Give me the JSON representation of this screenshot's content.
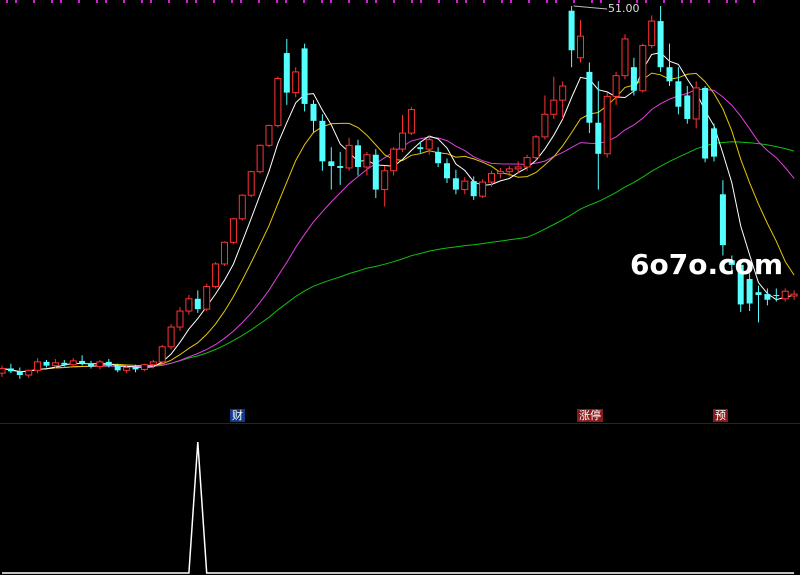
{
  "labels": {
    "finance_tag": "财",
    "limit_up_tag": "涨停",
    "forecast_tag": "预",
    "high_price": "51.00",
    "watermark": "6o7o.com"
  },
  "colors": {
    "background": "#000000",
    "up_candle": "#ff3232",
    "down_candle": "#54ffff",
    "ma5": "#ffffff",
    "ma10": "#e6c800",
    "ma20": "#e040e0",
    "ma60": "#10c010",
    "separator": "#800000",
    "indicator": "#ffffff"
  },
  "chart_data": [
    {
      "type": "candlestick",
      "y_range": [
        10,
        51
      ],
      "series": [
        {
          "name": "price",
          "points": [
            [
              12.0,
              12.8,
              11.6,
              12.5
            ],
            [
              12.5,
              13.0,
              12.0,
              12.2
            ],
            [
              12.2,
              12.6,
              11.4,
              11.8
            ],
            [
              11.8,
              12.4,
              11.5,
              12.3
            ],
            [
              12.3,
              13.6,
              12.0,
              13.2
            ],
            [
              13.2,
              13.4,
              12.6,
              12.8
            ],
            [
              12.8,
              13.5,
              12.5,
              13.1
            ],
            [
              13.1,
              13.4,
              12.7,
              12.9
            ],
            [
              12.9,
              13.6,
              12.6,
              13.3
            ],
            [
              13.3,
              13.9,
              12.8,
              13.0
            ],
            [
              13.0,
              13.3,
              12.5,
              12.7
            ],
            [
              12.7,
              13.4,
              12.4,
              13.2
            ],
            [
              13.2,
              13.5,
              12.6,
              12.8
            ],
            [
              12.8,
              13.0,
              12.1,
              12.3
            ],
            [
              12.3,
              12.8,
              12.0,
              12.6
            ],
            [
              12.6,
              12.9,
              12.1,
              12.4
            ],
            [
              12.4,
              13.0,
              12.2,
              12.9
            ],
            [
              12.9,
              13.4,
              12.5,
              13.2
            ],
            [
              13.2,
              15.0,
              13.0,
              14.8
            ],
            [
              14.8,
              17.2,
              14.5,
              16.9
            ],
            [
              16.9,
              19.0,
              16.5,
              18.6
            ],
            [
              18.6,
              20.3,
              18.2,
              19.9
            ],
            [
              19.9,
              20.8,
              18.4,
              18.8
            ],
            [
              18.8,
              21.5,
              18.6,
              21.2
            ],
            [
              21.2,
              23.8,
              21.0,
              23.6
            ],
            [
              23.6,
              26.0,
              23.4,
              25.9
            ],
            [
              25.9,
              28.5,
              25.7,
              28.4
            ],
            [
              28.4,
              31.0,
              28.2,
              30.9
            ],
            [
              30.9,
              33.5,
              30.7,
              33.4
            ],
            [
              33.4,
              36.3,
              33.2,
              36.2
            ],
            [
              36.2,
              38.4,
              36.0,
              38.3
            ],
            [
              38.3,
              43.5,
              38.1,
              43.3
            ],
            [
              46.0,
              47.5,
              40.5,
              41.8
            ],
            [
              41.8,
              44.5,
              41.3,
              44.0
            ],
            [
              46.5,
              47.0,
              39.8,
              40.6
            ],
            [
              40.6,
              41.0,
              37.5,
              38.8
            ],
            [
              38.8,
              39.5,
              33.5,
              34.5
            ],
            [
              34.5,
              36.0,
              31.5,
              34.0
            ],
            [
              34.0,
              35.5,
              32.0,
              33.8
            ],
            [
              33.8,
              37.0,
              33.5,
              36.2
            ],
            [
              36.2,
              36.8,
              33.0,
              33.9
            ],
            [
              33.9,
              35.5,
              33.0,
              35.2
            ],
            [
              35.2,
              35.8,
              30.6,
              31.5
            ],
            [
              31.5,
              34.0,
              29.7,
              33.5
            ],
            [
              33.5,
              36.0,
              33.0,
              35.8
            ],
            [
              35.8,
              39.4,
              35.5,
              37.5
            ],
            [
              37.5,
              40.3,
              37.3,
              40.0
            ],
            [
              36.0,
              36.6,
              35.4,
              35.8
            ],
            [
              35.8,
              37.2,
              35.2,
              36.8
            ],
            [
              35.5,
              36.0,
              33.9,
              34.3
            ],
            [
              34.3,
              34.8,
              32.2,
              32.7
            ],
            [
              32.7,
              33.6,
              31.0,
              31.5
            ],
            [
              31.5,
              32.8,
              31.0,
              32.4
            ],
            [
              32.4,
              32.9,
              30.4,
              30.8
            ],
            [
              30.8,
              32.6,
              30.6,
              32.3
            ],
            [
              32.3,
              33.5,
              31.8,
              33.2
            ],
            [
              33.2,
              33.8,
              32.7,
              33.4
            ],
            [
              33.4,
              34.0,
              32.9,
              33.7
            ],
            [
              33.7,
              34.5,
              33.2,
              33.9
            ],
            [
              33.9,
              35.2,
              33.5,
              34.9
            ],
            [
              34.9,
              37.3,
              34.6,
              37.1
            ],
            [
              37.1,
              41.5,
              36.8,
              39.5
            ],
            [
              39.5,
              43.5,
              39.0,
              41.0
            ],
            [
              41.0,
              43.0,
              39.0,
              42.5
            ],
            [
              50.5,
              51.0,
              44.5,
              46.3
            ],
            [
              45.5,
              49.5,
              45.0,
              47.8
            ],
            [
              44.0,
              45.0,
              37.5,
              38.6
            ],
            [
              38.6,
              43.0,
              31.5,
              35.3
            ],
            [
              35.3,
              41.8,
              34.9,
              41.4
            ],
            [
              41.4,
              44.0,
              40.5,
              43.6
            ],
            [
              43.6,
              48.0,
              43.2,
              47.5
            ],
            [
              44.5,
              45.5,
              41.5,
              42.0
            ],
            [
              42.0,
              47.0,
              41.8,
              46.8
            ],
            [
              46.8,
              50.0,
              46.5,
              49.4
            ],
            [
              49.4,
              51.0,
              44.0,
              44.5
            ],
            [
              44.5,
              47.0,
              42.5,
              43.0
            ],
            [
              43.0,
              44.5,
              39.5,
              40.3
            ],
            [
              41.5,
              42.5,
              38.5,
              39.0
            ],
            [
              39.0,
              43.0,
              38.0,
              42.3
            ],
            [
              42.3,
              42.5,
              34.4,
              34.8
            ],
            [
              38.0,
              38.5,
              34.5,
              35.0
            ],
            [
              31.0,
              32.5,
              24.5,
              25.6
            ],
            [
              24.0,
              24.5,
              22.5,
              23.5
            ],
            [
              23.5,
              24.0,
              18.5,
              19.3
            ],
            [
              22.0,
              22.6,
              18.6,
              19.4
            ],
            [
              20.6,
              21.3,
              17.4,
              20.3
            ],
            [
              20.4,
              21.0,
              19.2,
              19.8
            ],
            [
              20.3,
              21.0,
              19.6,
              20.2
            ],
            [
              19.9,
              21.0,
              19.6,
              20.7
            ],
            [
              20.2,
              20.8,
              19.8,
              20.4
            ]
          ]
        },
        {
          "name": "MA5"
        },
        {
          "name": "MA10"
        },
        {
          "name": "MA20"
        },
        {
          "name": "MA60"
        }
      ],
      "annotations": [
        {
          "text": "51.00",
          "value": 51.0
        },
        {
          "text": "财",
          "index": 22
        },
        {
          "text": "涨停",
          "index": 56
        },
        {
          "text": "预",
          "index": 70
        }
      ]
    },
    {
      "type": "line",
      "y_range": [
        0,
        1
      ],
      "values": [
        0,
        0,
        0,
        0,
        0,
        0,
        0,
        0,
        0,
        0,
        0,
        0,
        0,
        0,
        0,
        0,
        0,
        0,
        0,
        0,
        0,
        0,
        1,
        0,
        0,
        0,
        0,
        0,
        0,
        0,
        0,
        0,
        0,
        0,
        0,
        0,
        0,
        0,
        0,
        0,
        0,
        0,
        0,
        0,
        0,
        0,
        0,
        0,
        0,
        0,
        0,
        0,
        0,
        0,
        0,
        0,
        0,
        0,
        0,
        0,
        0,
        0,
        0,
        0,
        0,
        0,
        0,
        0,
        0,
        0,
        0,
        0,
        0,
        0,
        0,
        0,
        0,
        0,
        0,
        0,
        0,
        0,
        0,
        0,
        0,
        0,
        0,
        0,
        0,
        0
      ]
    }
  ]
}
